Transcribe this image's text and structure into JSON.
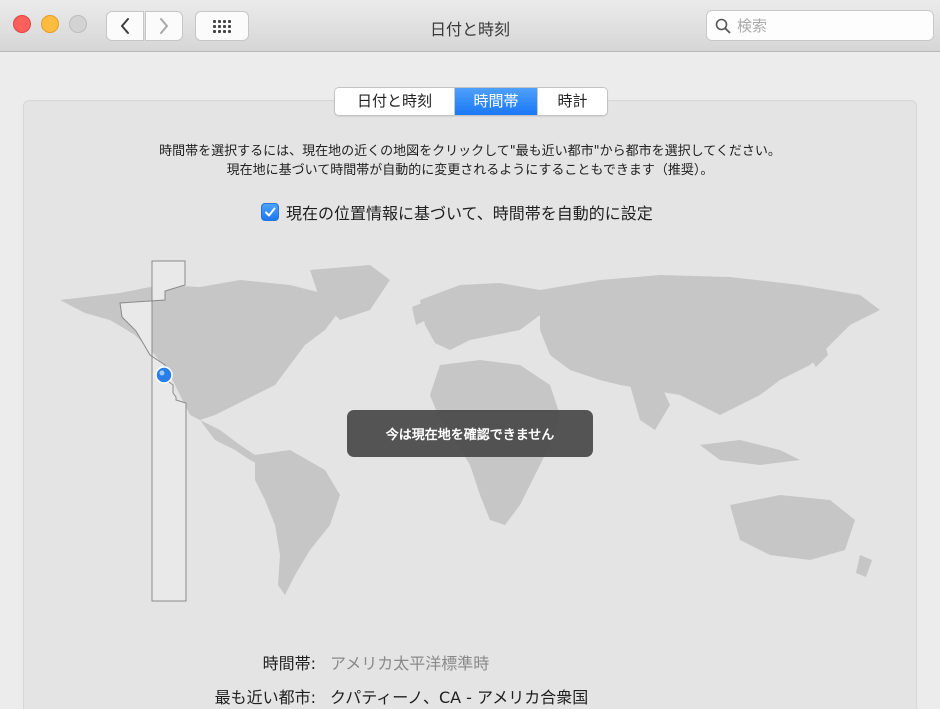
{
  "window": {
    "title": "日付と時刻"
  },
  "search": {
    "placeholder": "検索"
  },
  "tabs": [
    {
      "label": "日付と時刻",
      "active": false
    },
    {
      "label": "時間帯",
      "active": true
    },
    {
      "label": "時計",
      "active": false
    }
  ],
  "instructions": {
    "line1": "時間帯を選択するには、現在地の近くの地図をクリックして\"最も近い都市\"から都市を選択してください。",
    "line2": "現在地に基づいて時間帯が自動的に変更されるようにすることもできます（推奨）。"
  },
  "auto_timezone": {
    "label": "現在の位置情報に基づいて、時間帯を自動的に設定",
    "checked": true
  },
  "map": {
    "toast": "今は現在地を確認できません"
  },
  "info": {
    "timezone_label": "時間帯:",
    "timezone_value": "アメリカ太平洋標準時",
    "city_label": "最も近い都市:",
    "city_value": "クパティーノ、CA - アメリカ合衆国"
  },
  "colors": {
    "accent": "#1a78f6",
    "close": "#fc605c",
    "minimize": "#fdbc40",
    "maximize": "#d3d3d3"
  },
  "icons": [
    "chevron-left-icon",
    "chevron-right-icon",
    "grid-icon",
    "search-icon",
    "checkmark-icon",
    "location-pin-icon"
  ]
}
